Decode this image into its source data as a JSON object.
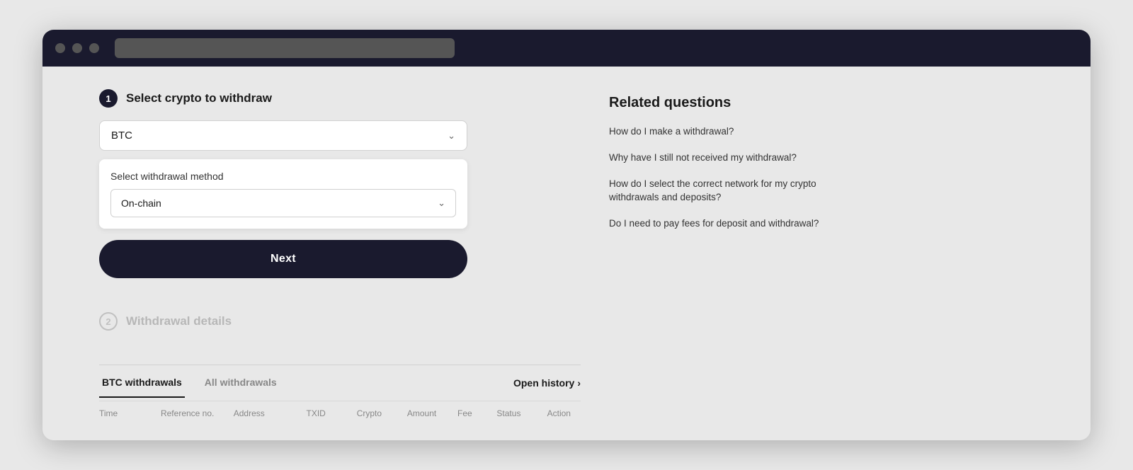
{
  "browser": {
    "address_bar_placeholder": ""
  },
  "step1": {
    "number": "1",
    "title": "Select crypto to withdraw",
    "crypto_value": "BTC",
    "withdrawal_method_label": "Select withdrawal method",
    "method_value": "On-chain",
    "next_button_label": "Next"
  },
  "step2": {
    "number": "2",
    "title": "Withdrawal details"
  },
  "history": {
    "tabs": [
      {
        "label": "BTC withdrawals",
        "active": true
      },
      {
        "label": "All withdrawals",
        "active": false
      }
    ],
    "open_history_label": "Open history",
    "columns": [
      "Time",
      "Reference no.",
      "Address",
      "TXID",
      "Crypto",
      "Amount",
      "Fee",
      "Status",
      "Action"
    ]
  },
  "related": {
    "title": "Related questions",
    "questions": [
      "How do I make a withdrawal?",
      "Why have I still not received my withdrawal?",
      "How do I select the correct network for my crypto withdrawals and deposits?",
      "Do I need to pay fees for deposit and withdrawal?"
    ]
  },
  "icons": {
    "chevron_down": "⌄",
    "chevron_right": "›"
  }
}
